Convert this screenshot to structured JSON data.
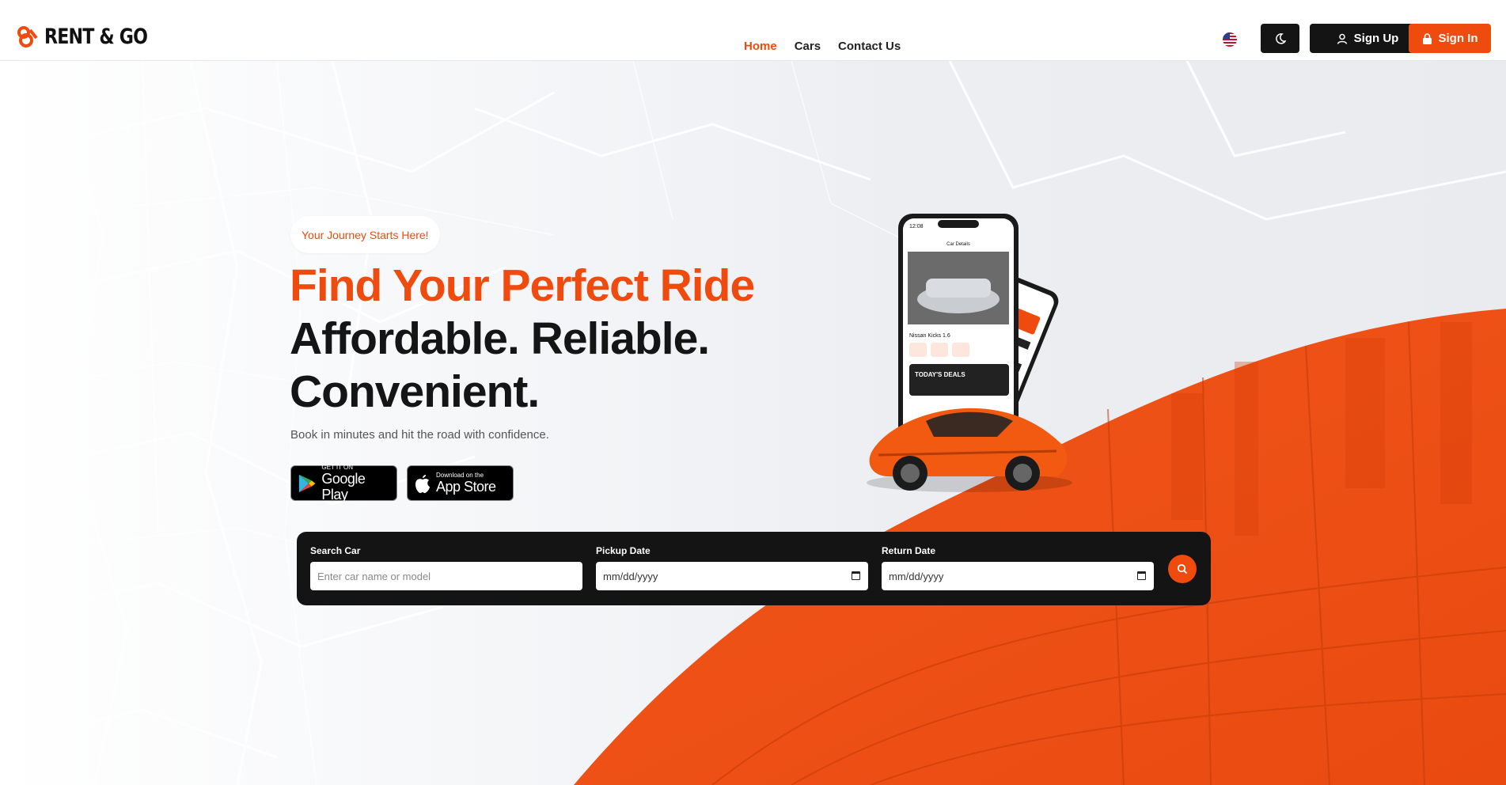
{
  "brand": {
    "name": "RENT & GO",
    "accent": "#f04b0e",
    "dark": "#141414"
  },
  "nav": [
    {
      "label": "Home",
      "active": true
    },
    {
      "label": "Cars",
      "active": false
    },
    {
      "label": "Contact Us",
      "active": false
    }
  ],
  "header": {
    "language_icon": "us-flag-icon",
    "theme_icon": "moon-icon",
    "sign_up": "Sign Up",
    "sign_in": "Sign In"
  },
  "hero": {
    "badge": "Your Journey Starts Here!",
    "headline_orange": "Find Your Perfect Ride",
    "headline_line2": "Affordable. Reliable.",
    "headline_line3": "Convenient.",
    "subtitle": "Book in minutes and hit the road with confidence.",
    "google_play": {
      "small": "GET IT ON",
      "big": "Google Play"
    },
    "app_store": {
      "small": "Download on the",
      "big": "App Store"
    }
  },
  "phone_mock": {
    "time": "12:08",
    "screen_title": "Car Details",
    "car_name": "Nissan Kicks 1.6",
    "promo": "TODAY'S DEALS"
  },
  "search": {
    "car_label": "Search Car",
    "car_placeholder": "Enter car name or model",
    "pickup_label": "Pickup Date",
    "pickup_value": "mm/dd/yyyy",
    "return_label": "Return Date",
    "return_value": "mm/dd/yyyy",
    "button_icon": "search-icon"
  }
}
